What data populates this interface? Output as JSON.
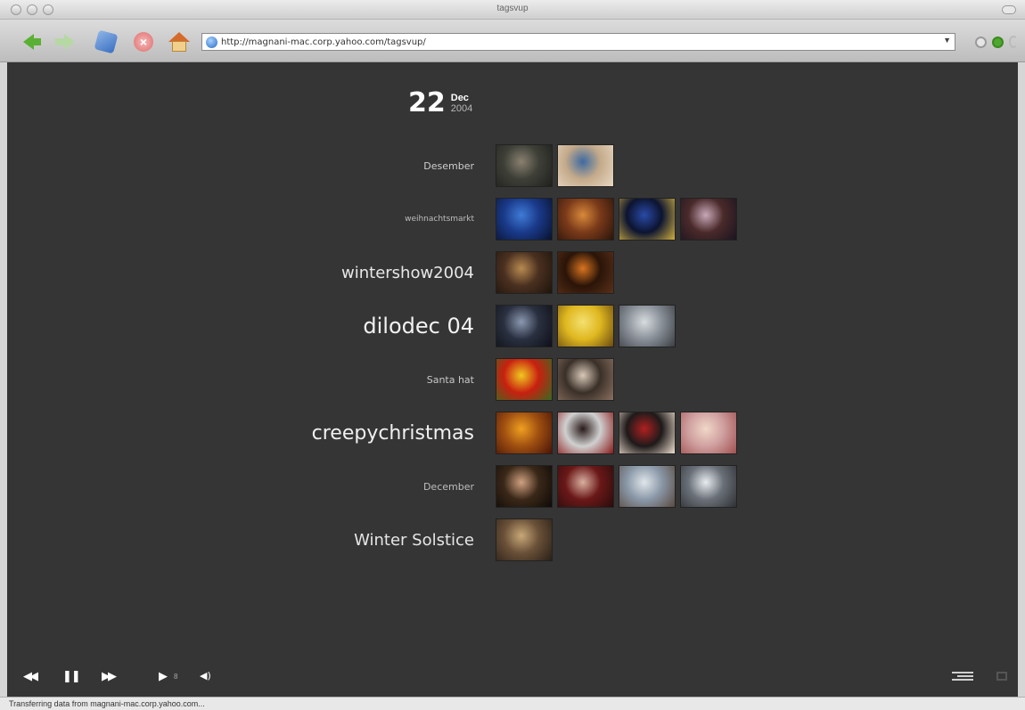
{
  "window": {
    "title": "tagsvup"
  },
  "toolbar": {
    "url": "http://magnani-mac.corp.yahoo.com/tagsvup/"
  },
  "content": {
    "date": {
      "day": "22",
      "month": "Dec",
      "year": "2004"
    },
    "tags": [
      {
        "label": "Desember",
        "size": 11,
        "color": "#cfcfcf",
        "photos": [
          "#3e4038|#8a8070|#1f201c",
          "#c4aa8a|#3d6aa0|#e8d7c4"
        ]
      },
      {
        "label": "weihnachtsmarkt",
        "size": 9,
        "color": "#bdbdbd",
        "photos": [
          "#1a3a8a|#3f7bd6|#08122e",
          "#7a3a1a|#d8893a|#2a140a",
          "#0c1430|#2a4aa8|#d0b040",
          "#4a2a2a|#c8a8b8|#1a1420"
        ]
      },
      {
        "label": "wintershow2004",
        "size": 18,
        "color": "#e8e8e8",
        "photos": [
          "#4a3020|#b88a50|#1e140c",
          "#2a1408|#d87420|#5a3018"
        ]
      },
      {
        "label": "dilodec 04",
        "size": 24,
        "color": "#f2f2f2",
        "photos": [
          "#2a3040|#8a98b0|#0e1018",
          "#e0b820|#f4e070|#6a4a10",
          "#8a9098|#d8dce0|#3a3e44"
        ]
      },
      {
        "label": "Santa hat",
        "size": 11,
        "color": "#c8c8c8",
        "photos": [
          "#c82010|#f0c820|#3a6a20",
          "#3a3028|#d8c8b8|#8a7060"
        ]
      },
      {
        "label": "creepychristmas",
        "size": 22,
        "color": "#f0f0f0",
        "photos": [
          "#a05010|#f0a020|#4a1408",
          "#d0d0d0|#2a1a1a|#8a1a1a",
          "#1e1a1a|#b02020|#f0e0d0",
          "#d0a0a0|#f0d8c8|#a05050"
        ]
      },
      {
        "label": "December",
        "size": 11,
        "color": "#bdbdbd",
        "photos": [
          "#3a2818|#d0a080|#0e0a08",
          "#6a1818|#d8b0a0|#2a0c0c",
          "#8a98a8|#e0e6ea|#5a4a40",
          "#6a7078|#e8ecf0|#2e3034"
        ]
      },
      {
        "label": "Winter Solstice",
        "size": 18,
        "color": "#e6e6e6",
        "photos": [
          "#6a5038|#c8a878|#2a2018"
        ]
      }
    ]
  },
  "player": {
    "rewind": "◀◀",
    "pause": "❚❚",
    "forward": "▶▶",
    "speed": "▶",
    "speed_level": "8",
    "volume": "◀)"
  },
  "status": {
    "text": "Transferring data from magnani-mac.corp.yahoo.com..."
  }
}
